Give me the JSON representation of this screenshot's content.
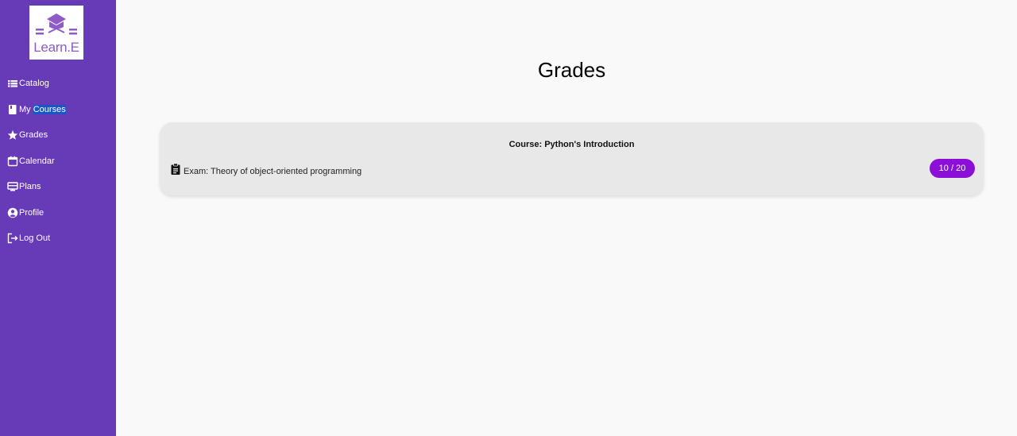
{
  "brand": {
    "logo_text": "Learn.E"
  },
  "sidebar": {
    "items": [
      {
        "label_pre": "",
        "label_hl": "",
        "label": "Catalog",
        "icon": "list-icon"
      },
      {
        "label_pre": "My ",
        "label_hl": "Courses",
        "label": "",
        "icon": "book-icon"
      },
      {
        "label_pre": "",
        "label_hl": "",
        "label": "Grades",
        "icon": "star-icon"
      },
      {
        "label_pre": "",
        "label_hl": "",
        "label": "Calendar",
        "icon": "calendar-icon"
      },
      {
        "label_pre": "",
        "label_hl": "",
        "label": "Plans",
        "icon": "monitor-icon"
      },
      {
        "label_pre": "",
        "label_hl": "",
        "label": "Profile",
        "icon": "account-circle-icon"
      },
      {
        "label_pre": "",
        "label_hl": "",
        "label": "Log Out",
        "icon": "logout-icon"
      }
    ]
  },
  "main": {
    "title": "Grades",
    "card": {
      "course": "Course: Python's Introduction",
      "exam": "Exam: Theory of object-oriented programming",
      "grade": "10 / 20",
      "icon": "clipboard-icon"
    }
  },
  "colors": {
    "sidebar_bg": "#673ab7",
    "accent_badge": "#8b0fd6",
    "text_highlight": "#1a54c9",
    "card_bg": "#e8e8e8",
    "page_bg": "#f9f9f9"
  }
}
